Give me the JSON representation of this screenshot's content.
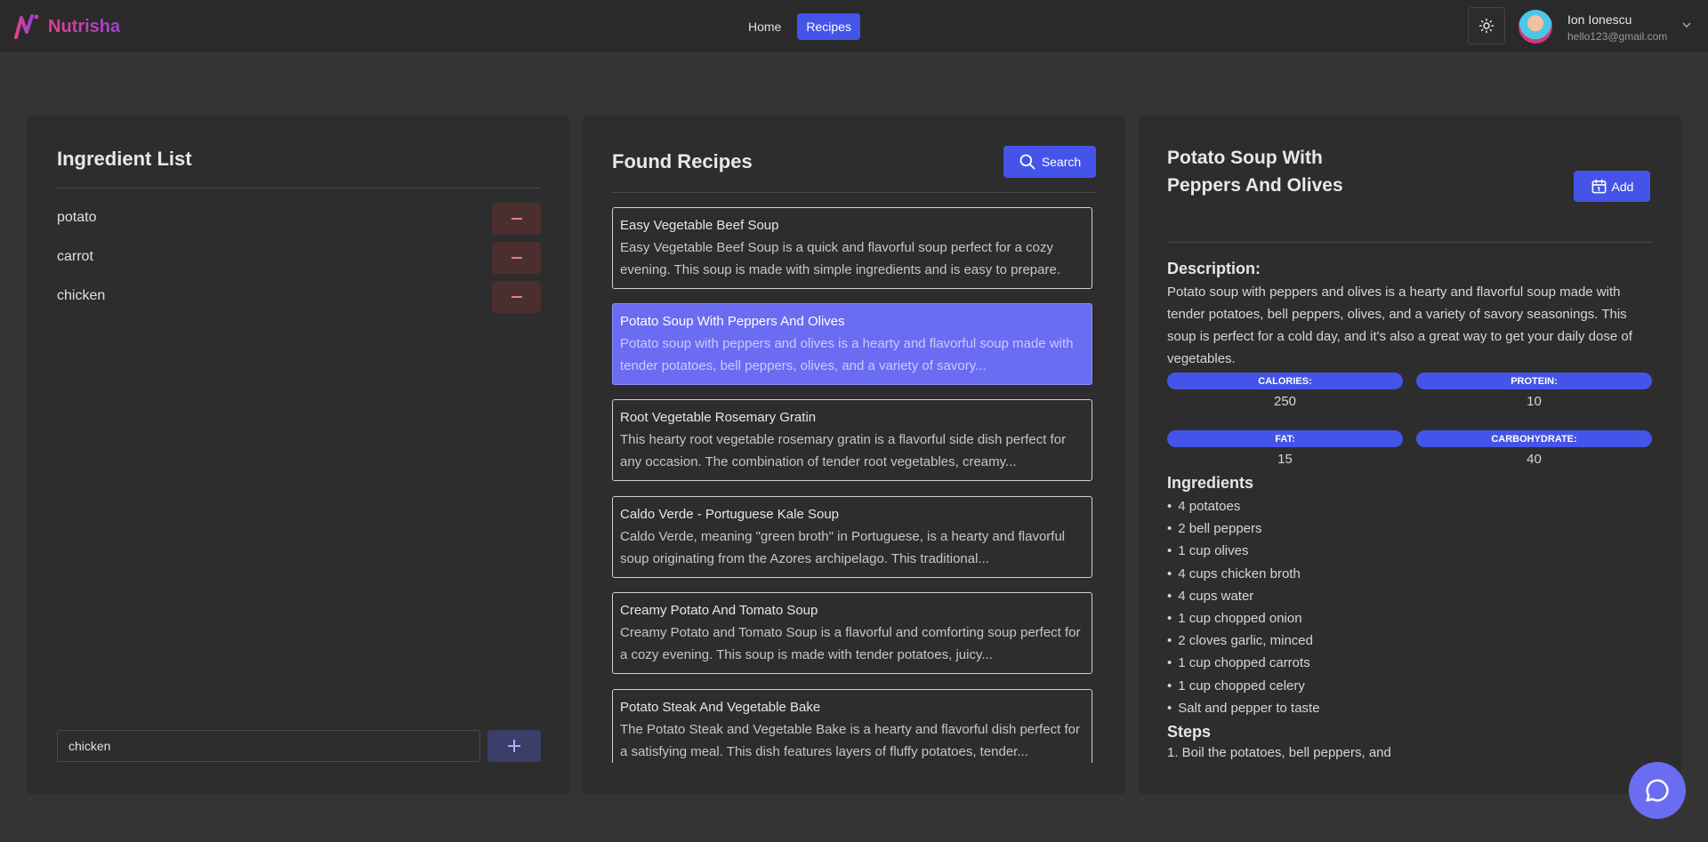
{
  "brand": {
    "name": "Nutrisha"
  },
  "nav": {
    "home": "Home",
    "recipes": "Recipes"
  },
  "user": {
    "name": "Ion Ionescu",
    "email": "hello123@gmail.com"
  },
  "ingredient_panel": {
    "title": "Ingredient List",
    "items": [
      "potato",
      "carrot",
      "chicken"
    ],
    "input_value": "chicken"
  },
  "recipes_panel": {
    "title": "Found Recipes",
    "search_label": "Search",
    "recipes": [
      {
        "title": "Easy Vegetable Beef Soup",
        "desc": "Easy Vegetable Beef Soup is a quick and flavorful soup perfect for a cozy evening. This soup is made with simple ingredients and is easy to prepare."
      },
      {
        "title": "Potato Soup With Peppers And Olives",
        "desc": "Potato soup with peppers and olives is a hearty and flavorful soup made with tender potatoes, bell peppers, olives, and a variety of savory..."
      },
      {
        "title": "Root Vegetable Rosemary Gratin",
        "desc": "This hearty root vegetable rosemary gratin is a flavorful side dish perfect for any occasion. The combination of tender root vegetables, creamy..."
      },
      {
        "title": "Caldo Verde - Portuguese Kale Soup",
        "desc": "Caldo Verde, meaning \"green broth\" in Portuguese, is a hearty and flavorful soup originating from the Azores archipelago. This traditional..."
      },
      {
        "title": "Creamy Potato And Tomato Soup",
        "desc": "Creamy Potato and Tomato Soup is a flavorful and comforting soup perfect for a cozy evening. This soup is made with tender potatoes, juicy..."
      },
      {
        "title": "Potato Steak And Vegetable Bake",
        "desc": "The Potato Steak and Vegetable Bake is a hearty and flavorful dish perfect for a satisfying meal. This dish features layers of fluffy potatoes, tender..."
      }
    ],
    "selected_index": 1
  },
  "detail": {
    "title": "Potato Soup With Peppers And Olives",
    "add_label": "Add",
    "description_label": "Description:",
    "description": "Potato soup with peppers and olives is a hearty and flavorful soup made with tender potatoes, bell peppers, olives, and a variety of savory seasonings. This soup is perfect for a cold day, and it's also a great way to get your daily dose of vegetables.",
    "macros": {
      "calories_label": "CALORIES:",
      "calories": "250",
      "protein_label": "PROTEIN:",
      "protein": "10",
      "fat_label": "FAT:",
      "fat": "15",
      "carbs_label": "CARBOHYDRATE:",
      "carbs": "40"
    },
    "ingredients_label": "Ingredients",
    "ingredients": [
      "4 potatoes",
      "2 bell peppers",
      "1 cup olives",
      "4 cups chicken broth",
      "4 cups water",
      "1 cup chopped onion",
      "2 cloves garlic, minced",
      "1 cup chopped carrots",
      "1 cup chopped celery",
      "Salt and pepper to taste"
    ],
    "steps_label": "Steps",
    "steps_first": "1. Boil the potatoes, bell peppers, and"
  },
  "colors": {
    "accent": "#4554e8",
    "selected_card": "#6a6cf2",
    "remove_btn": "#4b2f2f",
    "background": "#343434",
    "panel": "#2d2d2d"
  },
  "icons": {
    "theme": "sun-icon",
    "search": "search-icon",
    "calendar": "calendar-icon",
    "chat": "chat-icon",
    "plus": "plus-icon",
    "minus": "minus-icon"
  }
}
